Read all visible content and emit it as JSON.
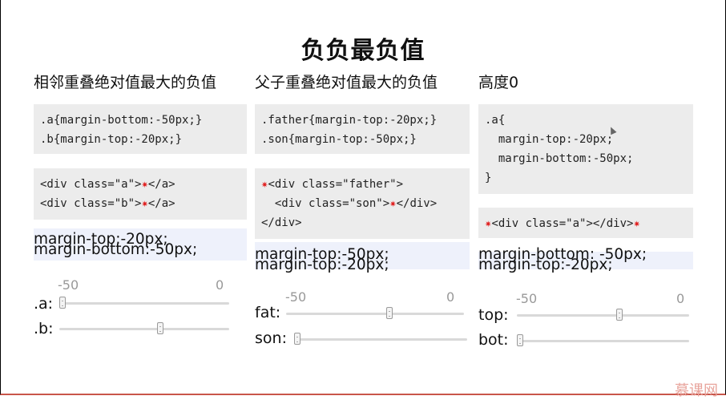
{
  "title": "负负最负值",
  "columns": [
    {
      "heading": "相邻重叠绝对值最大的负值",
      "css_lines": [
        ".a{margin-bottom:-50px;}",
        ".b{margin-top:-20px;}"
      ],
      "html_lines": [
        {
          "pre": "<div class=\"a\">",
          "star": "✷",
          "post": "</a>"
        },
        {
          "pre": "<div class=\"b\">",
          "star": "✷",
          "post": "</a>"
        }
      ],
      "note_lines": [
        "margin-top:-20px;",
        "margin-bottom:-50px;"
      ],
      "ticks": [
        "-50",
        "0"
      ],
      "sliders": [
        {
          "label": ".a:",
          "value": -50
        },
        {
          "label": ".b:",
          "value": -20
        }
      ]
    },
    {
      "heading": "父子重叠绝对值最大的负值",
      "css_lines": [
        ".father{margin-top:-20px;}",
        ".son{margin-top:-50px;}"
      ],
      "html_lines": [
        {
          "lead_star": "✷",
          "pre": "<div class=\"father\">"
        },
        {
          "pre": "  <div class=\"son\">",
          "star": "✷",
          "post": "</div>"
        },
        {
          "pre": "</div>"
        }
      ],
      "note_lines": [
        "margin-top:-50px;",
        "margin-top:-20px;"
      ],
      "ticks": [
        "-50",
        "0"
      ],
      "sliders": [
        {
          "label": "fat:",
          "value": -20
        },
        {
          "label": "son:",
          "value": -50
        }
      ]
    },
    {
      "heading": "高度0",
      "css_lines": [
        ".a{",
        "  margin-top:-20px;",
        "  margin-bottom:-50px;",
        "}"
      ],
      "html_lines": [
        {
          "lead_star": "✷",
          "pre": "<div class=\"a\"></div>",
          "star": "✷"
        }
      ],
      "note_lines": [
        "margin-bottom: -50px;",
        "margin-top:-20px;"
      ],
      "ticks": [
        "-50",
        "0"
      ],
      "sliders": [
        {
          "label": "top:",
          "value": -20
        },
        {
          "label": "bot:",
          "value": -50
        }
      ]
    }
  ],
  "watermark": "慕课网"
}
